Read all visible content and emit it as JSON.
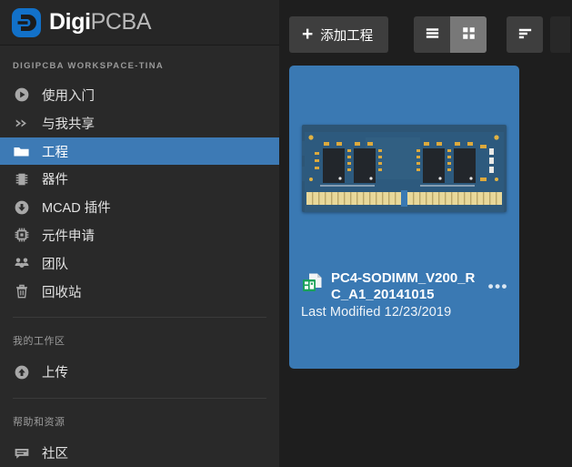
{
  "brand": {
    "logo_icon": "digipcba-logo-icon",
    "name_bold": "Digi",
    "name_light": "PCBA"
  },
  "sidebar": {
    "workspace_label": "DIGIPCBA WORKSPACE-TINA",
    "items": [
      {
        "label": "使用入门",
        "icon": "play-circle-icon",
        "active": false
      },
      {
        "label": "与我共享",
        "icon": "double-chevron-right-icon",
        "active": false
      },
      {
        "label": "工程",
        "icon": "folder-icon",
        "active": true
      },
      {
        "label": "器件",
        "icon": "ic-chip-icon",
        "active": false
      },
      {
        "label": "MCAD 插件",
        "icon": "download-circle-icon",
        "active": false
      },
      {
        "label": "元件申请",
        "icon": "cpu-icon",
        "active": false
      },
      {
        "label": "团队",
        "icon": "team-icon",
        "active": false
      },
      {
        "label": "回收站",
        "icon": "trash-icon",
        "active": false
      }
    ],
    "workspace_section_label": "我的工作区",
    "workspace_items": [
      {
        "label": "上传",
        "icon": "upload-circle-icon"
      }
    ],
    "help_section_label": "帮助和资源",
    "help_items": [
      {
        "label": "社区",
        "icon": "comment-icon"
      }
    ]
  },
  "toolbar": {
    "add_project_label": "添加工程",
    "add_icon": "plus-icon",
    "list_view_icon": "list-view-icon",
    "grid_view_icon": "grid-view-icon",
    "sort_icon": "sort-icon",
    "active_view": "grid"
  },
  "project_card": {
    "title": "PC4-SODIMM_V200_RC_A1_20141015",
    "subtitle": "Last Modified 12/23/2019",
    "file_icon": "pcb-document-icon",
    "more_icon": "more-options-icon",
    "thumbnail_alt": "sodimm-pcb-thumbnail"
  },
  "colors": {
    "accent_blue": "#3d7ab5",
    "card_blue": "#3a79b3",
    "sidebar_bg": "#292929",
    "main_bg": "#1e1e1e",
    "logo_blue": "#1271c9"
  }
}
